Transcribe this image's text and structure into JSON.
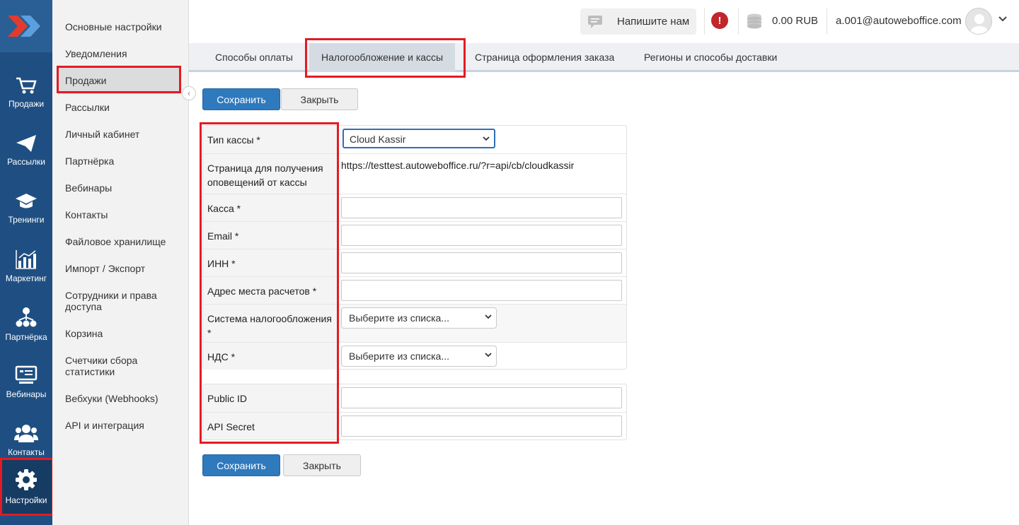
{
  "rail": {
    "items": [
      {
        "label": "Продажи",
        "icon": "cart-icon"
      },
      {
        "label": "Рассылки",
        "icon": "paper-plane-icon"
      },
      {
        "label": "Тренинги",
        "icon": "graduation-cap-icon"
      },
      {
        "label": "Маркетинг",
        "icon": "bar-chart-icon"
      },
      {
        "label": "Партнёрка",
        "icon": "network-icon"
      },
      {
        "label": "Вебинары",
        "icon": "presentation-icon"
      },
      {
        "label": "Контакты",
        "icon": "users-icon"
      },
      {
        "label": "Настройки",
        "icon": "gear-icon"
      }
    ],
    "active": "Настройки"
  },
  "subnav": {
    "items": [
      "Основные настройки",
      "Уведомления",
      "Продажи",
      "Рассылки",
      "Личный кабинет",
      "Партнёрка",
      "Вебинары",
      "Контакты",
      "Файловое хранилище",
      "Импорт / Экспорт",
      "Сотрудники и права доступа",
      "Корзина",
      "Счетчики сбора статистики",
      "Вебхуки (Webhooks)",
      "API и интеграция"
    ],
    "active": "Продажи"
  },
  "header": {
    "message_button": "Напишите нам",
    "balance": "0.00 RUB",
    "user_email": "a.001@autoweboffice.com"
  },
  "tabs": [
    "Способы оплаты",
    "Налогообложение и кассы",
    "Страница оформления заказа",
    "Регионы и способы доставки"
  ],
  "active_tab": "Налогообложение и кассы",
  "buttons": {
    "save": "Сохранить",
    "close": "Закрыть"
  },
  "form": {
    "cashbox_type": {
      "label": "Тип кассы *",
      "value": "Cloud Kassir"
    },
    "notify_page": {
      "label": "Страница для получения оповещений от кассы",
      "value": "https://testtest.autoweboffice.ru/?r=api/cb/cloudkassir"
    },
    "kassa": {
      "label": "Касса *",
      "value": ""
    },
    "email": {
      "label": "Email *",
      "value": ""
    },
    "inn": {
      "label": "ИНН *",
      "value": ""
    },
    "address": {
      "label": "Адрес места расчетов *",
      "value": ""
    },
    "tax_system": {
      "label": "Система налогообложения *",
      "value": "Выберите из списка..."
    },
    "vat": {
      "label": "НДС *",
      "value": "Выберите из списка..."
    },
    "public_id": {
      "label": "Public ID",
      "value": ""
    },
    "api_secret": {
      "label": "API Secret",
      "value": ""
    }
  },
  "colors": {
    "rail_bg": "#1f4f82",
    "highlight": "#e31b23",
    "primary_button": "#2f79bd"
  }
}
